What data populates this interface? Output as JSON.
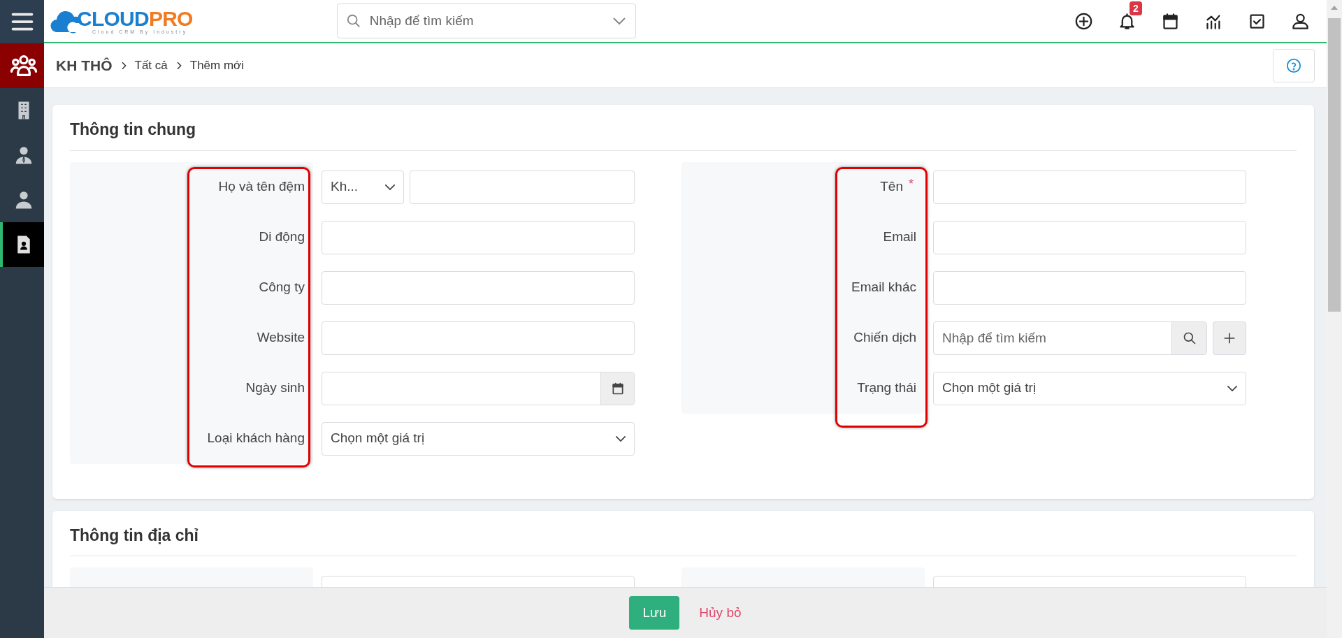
{
  "sidebar": {
    "items": [
      {
        "kind": "group",
        "selected": false,
        "highlighted": true
      },
      {
        "kind": "building",
        "selected": false,
        "highlighted": false
      },
      {
        "kind": "person-tie",
        "selected": false,
        "highlighted": false
      },
      {
        "kind": "person",
        "selected": false,
        "highlighted": false
      },
      {
        "kind": "contact",
        "selected": true,
        "highlighted": false
      }
    ]
  },
  "logo": {
    "part1": "CLOUD",
    "part2": "PRO",
    "tagline": "Cloud CRM By Industry"
  },
  "search": {
    "placeholder": "Nhập để tìm kiếm"
  },
  "toolbar": [
    {
      "kind": "add"
    },
    {
      "kind": "bell",
      "badge": "2"
    },
    {
      "kind": "calendar"
    },
    {
      "kind": "chart"
    },
    {
      "kind": "task"
    },
    {
      "kind": "user"
    }
  ],
  "breadcrumb": [
    "KH THÔ",
    "Tất cả",
    "Thêm mới"
  ],
  "sections": [
    {
      "title": "Thông tin chung",
      "highlighted": true,
      "columns": [
        [
          {
            "label": "Họ và tên đệm",
            "kind": "salutation",
            "value": "Kh..."
          },
          {
            "label": "Di động",
            "kind": "text"
          },
          {
            "label": "Công ty",
            "kind": "text"
          },
          {
            "label": "Website",
            "kind": "text"
          },
          {
            "label": "Ngày sinh",
            "kind": "date"
          },
          {
            "label": "Loại khách hàng",
            "kind": "select",
            "value": "Chọn một giá trị"
          }
        ],
        [
          {
            "label": "Tên",
            "kind": "text",
            "marker": "*"
          },
          {
            "label": "Email",
            "kind": "text"
          },
          {
            "label": "Email khác",
            "kind": "text"
          },
          {
            "label": "Chiến dịch",
            "kind": "lookup",
            "placeholder": "Nhập để tìm kiếm"
          },
          {
            "label": "Trạng thái",
            "kind": "select",
            "value": "Chọn một giá trị"
          }
        ]
      ]
    },
    {
      "title": "Thông tin địa chỉ",
      "highlighted": false,
      "columns": [
        [
          {
            "kind": "text"
          }
        ],
        [
          {
            "kind": "text"
          }
        ]
      ]
    }
  ],
  "footer": {
    "save": "Lưu",
    "cancel": "Hủy bỏ"
  }
}
